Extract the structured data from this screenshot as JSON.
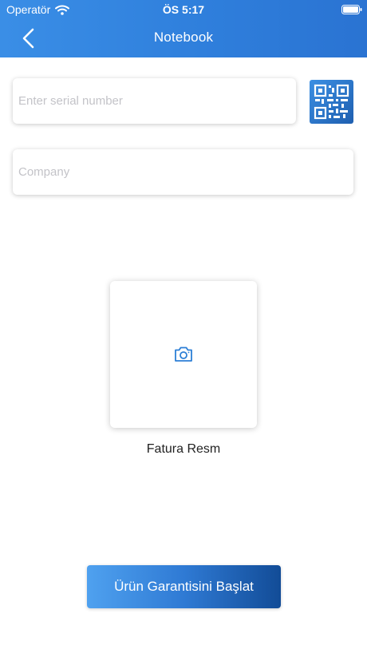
{
  "status_bar": {
    "carrier": "Operatör",
    "time": "ÖS 5:17",
    "wifi_icon": "wifi-icon",
    "battery_icon": "battery-icon"
  },
  "nav": {
    "back_icon": "chevron-left-icon",
    "title": "Notebook"
  },
  "form": {
    "serial": {
      "value": "",
      "placeholder": "Enter serial number"
    },
    "qr_icon": "qr-code-icon",
    "company": {
      "value": "",
      "placeholder": "Company"
    }
  },
  "invoice_photo": {
    "icon": "camera-icon",
    "label": "Fatura Resm"
  },
  "actions": {
    "start_label": "Ürün Garantisini Başlat"
  },
  "colors": {
    "header": "#2f7fdc",
    "accent": "#2c7fd6",
    "button_start": "#4fa1ef",
    "button_end": "#124c97"
  }
}
